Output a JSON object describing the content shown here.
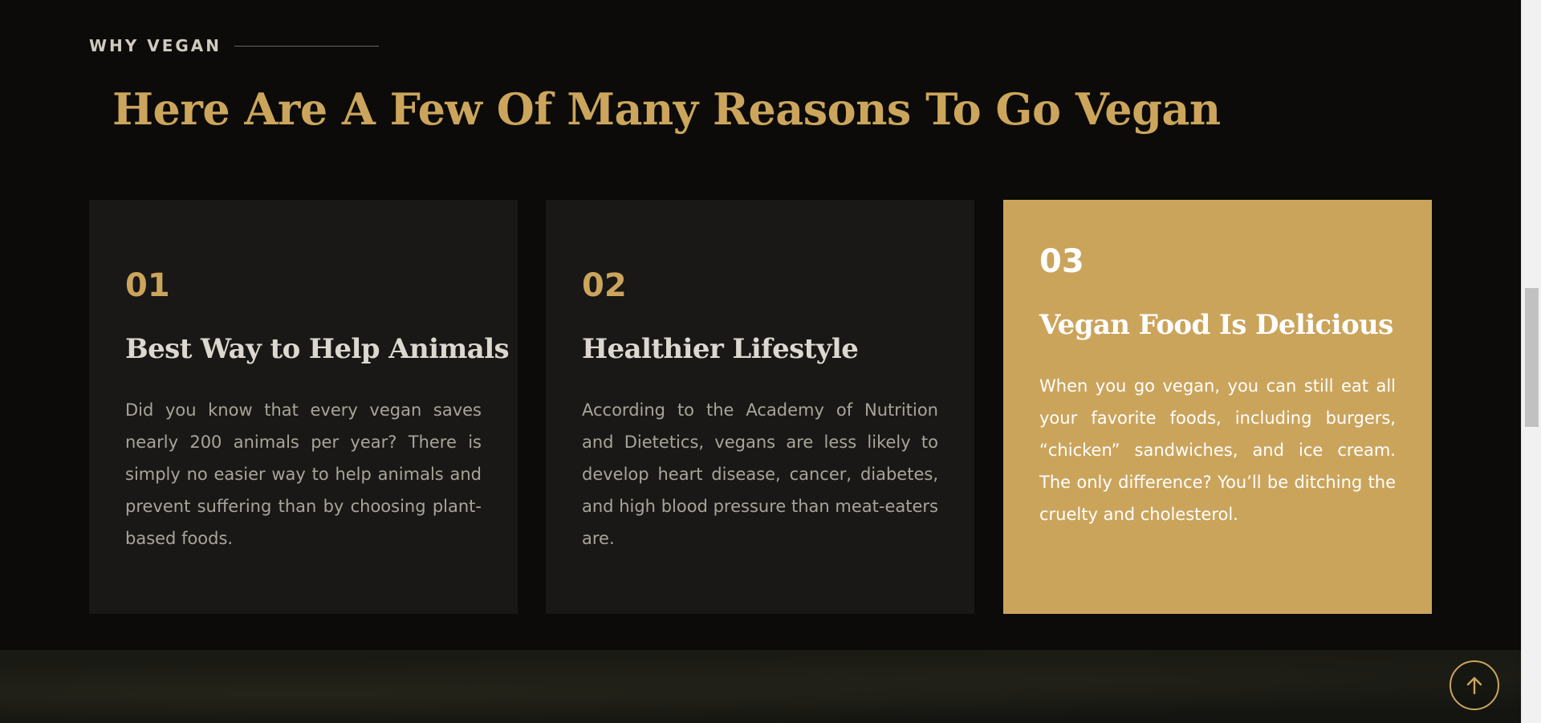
{
  "section": {
    "eyebrow": "WHY VEGAN",
    "headline": "Here Are A Few Of Many Reasons To Go Vegan"
  },
  "cards": [
    {
      "number": "01",
      "title": "Best Way to Help Animals",
      "body": "Did you know that every vegan saves nearly 200 animals per year? There is simply no easier way to help animals and prevent suffering than by choosing plant-based foods.",
      "highlighted": false
    },
    {
      "number": "02",
      "title": "Healthier Lifestyle",
      "body": "According to the Academy of Nutrition and Dietetics, vegans are less likely to develop heart disease, cancer, diabetes, and high blood pressure than meat-eaters are.",
      "highlighted": false
    },
    {
      "number": "03",
      "title": "Vegan Food Is Delicious",
      "body": "When you go vegan, you can still eat all your favorite foods, including burgers, “chicken” sandwiches, and ice cream. The only difference? You’ll be ditching the cruelty and cholesterol.",
      "highlighted": true
    }
  ],
  "back_to_top": {
    "icon": "arrow-up-icon"
  },
  "colors": {
    "background": "#0c0b09",
    "card": "#191816",
    "accent": "#cba45c",
    "heading_text": "#dcd8d0",
    "body_text": "#a9a49b"
  }
}
